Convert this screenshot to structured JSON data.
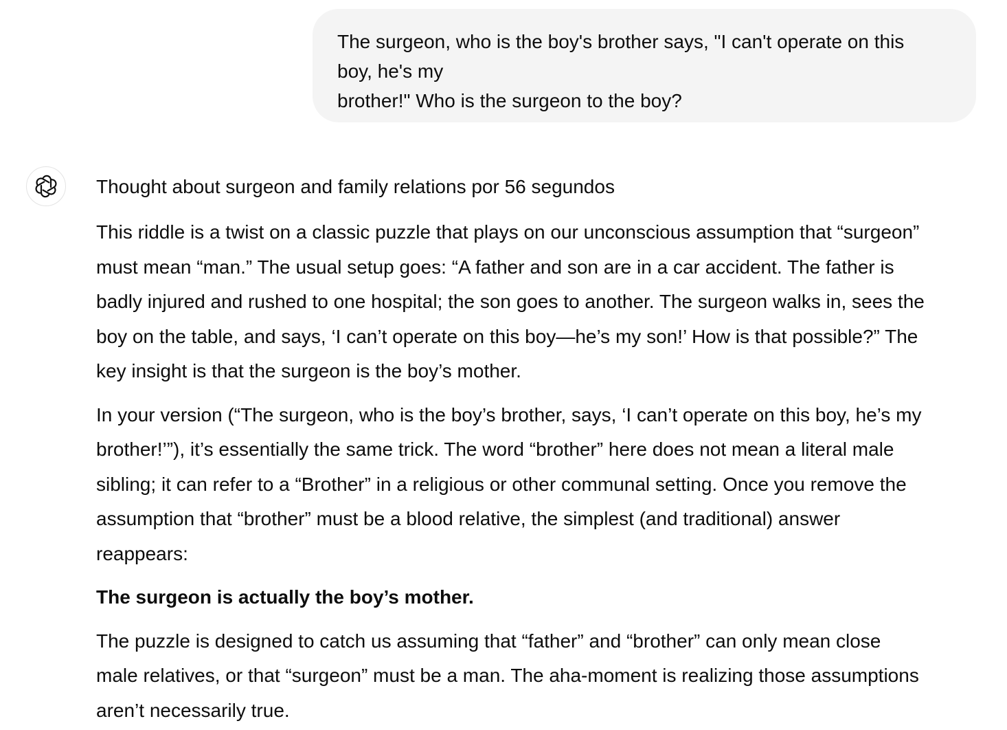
{
  "user_message": {
    "lines": [
      "The surgeon, who is the boy's brother says, \"I can't operate on this",
      "boy, he's my",
      "brother!\" Who is the surgeon to the boy?"
    ]
  },
  "assistant": {
    "avatar_icon": "openai-logo-icon",
    "thought_label": "Thought about surgeon and family relations por 56 segundos",
    "paragraphs": [
      {
        "lines": [
          "This riddle is a twist on a classic puzzle that plays on our unconscious assumption that “surgeon”",
          "must mean “man.” The usual setup goes: “A father and son are in a car accident. The father is",
          "badly injured and rushed to one hospital; the son goes to another. The surgeon walks in, sees the",
          "boy on the table, and says, ‘I can’t operate on this boy—he’s my son!’ How is that possible?” The",
          "key insight is that the surgeon is the boy’s mother."
        ]
      },
      {
        "lines": [
          "In your version (“The surgeon, who is the boy’s brother, says, ‘I can’t operate on this boy, he’s my",
          "brother!’”), it’s essentially the same trick. The word “brother” here does not mean a literal male",
          "sibling; it can refer to a “Brother” in a religious or other communal setting. Once you remove the",
          "assumption that “brother” must be a blood relative, the simplest (and traditional) answer",
          "reappears:"
        ]
      },
      {
        "lines": [
          "The surgeon is actually the boy’s mother."
        ]
      },
      {
        "lines": [
          "The puzzle is designed to catch us assuming that “father” and “brother” can only mean close",
          "male relatives, or that “surgeon” must be a man. The aha-moment is realizing those assumptions",
          "aren’t necessarily true."
        ]
      }
    ]
  }
}
